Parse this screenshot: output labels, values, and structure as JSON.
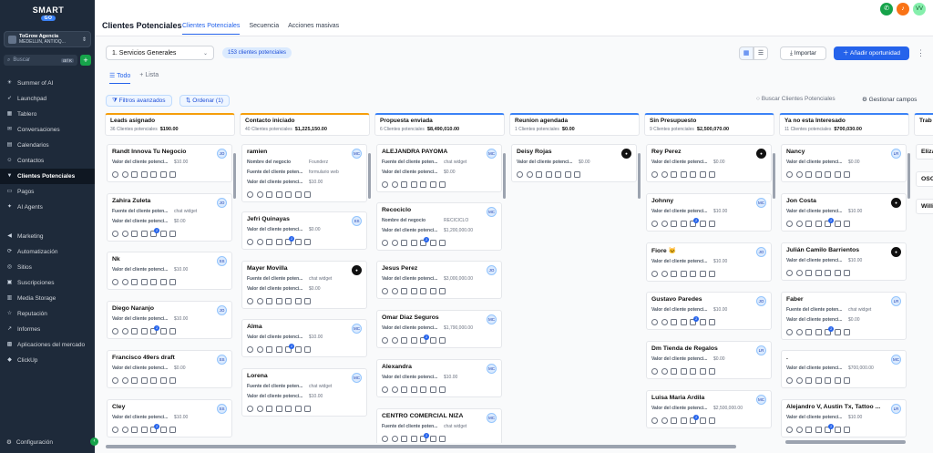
{
  "brand": {
    "name": "SMART",
    "sub": "GO"
  },
  "account": {
    "name": "ToGrow Agencia",
    "location": "MEDELLIN, ANTIOQ..."
  },
  "sidebar": {
    "search_placeholder": "Buscar",
    "shortcut": "ctrl K",
    "items": [
      {
        "label": "Summer of AI",
        "icon": "sun-icon"
      },
      {
        "label": "Launchpad",
        "icon": "rocket-icon"
      },
      {
        "label": "Tablero",
        "icon": "grid-icon"
      },
      {
        "label": "Conversaciones",
        "icon": "chat-icon"
      },
      {
        "label": "Calendarios",
        "icon": "calendar-icon"
      },
      {
        "label": "Contactos",
        "icon": "contacts-icon"
      },
      {
        "label": "Clientes Potenciales",
        "icon": "funnel-icon",
        "active": true
      },
      {
        "label": "Pagos",
        "icon": "card-icon"
      },
      {
        "label": "AI Agents",
        "icon": "sparkle-icon"
      },
      {
        "label": "Marketing",
        "icon": "megaphone-icon"
      },
      {
        "label": "Automatización",
        "icon": "automation-icon"
      },
      {
        "label": "Sitios",
        "icon": "globe-icon"
      },
      {
        "label": "Suscripciones",
        "icon": "subscription-icon"
      },
      {
        "label": "Media Storage",
        "icon": "storage-icon"
      },
      {
        "label": "Reputación",
        "icon": "star-icon"
      },
      {
        "label": "Informes",
        "icon": "chart-icon"
      },
      {
        "label": "Aplicaciones del mercado",
        "icon": "apps-icon"
      },
      {
        "label": "ClickUp",
        "icon": "clickup-icon"
      }
    ],
    "settings": "Configuración"
  },
  "header": {
    "title": "Clientes Potenciales",
    "tabs": [
      "Clientes Potenciales",
      "Secuencia",
      "Acciones masivas"
    ],
    "user_initials": "VV"
  },
  "toolbar": {
    "pipeline": "1. Servicios Generales",
    "count": "153 clientes potenciales",
    "import": "Importar",
    "add": "Añadir oportunidad",
    "view_tabs": [
      "Todo",
      "Lista"
    ],
    "filters": "Filtros avanzados",
    "sort": "Ordenar (1)",
    "search_placeholder": "Buscar Clientes Potenciales",
    "manage": "Gestionar campos"
  },
  "colors": {
    "accent": "#2563eb",
    "sidebar": "#1e2a3a"
  },
  "columns": [
    {
      "name": "Leads asignado",
      "count": "36 Clientes potenciales",
      "value": "$190.00",
      "color": "#f59e0b",
      "cards": [
        {
          "name": "Randt Innova Tu Negocio",
          "av": "JO",
          "fields": [
            [
              "Valor del cliente potenci...",
              "$10.00"
            ]
          ]
        },
        {
          "name": "Zahira Zuleta",
          "av": "JO",
          "fields": [
            [
              "Fuente del cliente poten...",
              "chat widget"
            ],
            [
              "Valor del cliente potenci...",
              "$0.00"
            ]
          ]
        },
        {
          "name": "Nk",
          "av": "SS",
          "fields": [
            [
              "Valor del cliente potenci...",
              "$10.00"
            ]
          ]
        },
        {
          "name": "Diego Naranjo",
          "av": "JO",
          "fields": [
            [
              "Valor del cliente potenci...",
              "$10.00"
            ]
          ]
        },
        {
          "name": "Francisco 49ers draft",
          "av": "SS",
          "fields": [
            [
              "Valor del cliente potenci...",
              "$0.00"
            ]
          ]
        },
        {
          "name": "Cley",
          "av": "SS",
          "fields": [
            [
              "Valor del cliente potenci...",
              "$10.00"
            ]
          ]
        }
      ]
    },
    {
      "name": "Contacto iniciado",
      "count": "40 Clientes potenciales",
      "value": "$1,225,150.00",
      "color": "#f59e0b",
      "cards": [
        {
          "name": "ramien",
          "av": "MC",
          "fields": [
            [
              "Nombre del negocio",
              "Founderz"
            ],
            [
              "Fuente del cliente poten...",
              "formulario web"
            ],
            [
              "Valor del cliente potenci...",
              "$10.00"
            ]
          ]
        },
        {
          "name": "Jefri Quinayas",
          "av": "SS",
          "fields": [
            [
              "Valor del cliente potenci...",
              "$0.00"
            ]
          ]
        },
        {
          "name": "Mayer Movilla",
          "av": "",
          "dark": true,
          "fields": [
            [
              "Fuente del cliente poten...",
              "chat widget"
            ],
            [
              "Valor del cliente potenci...",
              "$0.00"
            ]
          ]
        },
        {
          "name": "Alma",
          "av": "MC",
          "fields": [
            [
              "Valor del cliente potenci...",
              "$10.00"
            ]
          ]
        },
        {
          "name": "Lorena",
          "av": "MC",
          "fields": [
            [
              "Fuente del cliente poten...",
              "chat widget"
            ],
            [
              "Valor del cliente potenci...",
              "$10.00"
            ]
          ]
        }
      ]
    },
    {
      "name": "Propuesta enviada",
      "count": "6 Clientes potenciales",
      "value": "$8,490,010.00",
      "color": "#3b82f6",
      "cards": [
        {
          "name": "ALEJANDRA PAYOMA",
          "av": "MC",
          "fields": [
            [
              "Fuente del cliente poten...",
              "chat widget"
            ],
            [
              "Valor del cliente potenci...",
              "$0.00"
            ]
          ]
        },
        {
          "name": "Recociclo",
          "av": "MC",
          "fields": [
            [
              "Nombre del negocio",
              "RECICICLO"
            ],
            [
              "Valor del cliente potenci...",
              "$1,200,000.00"
            ]
          ]
        },
        {
          "name": "Jesus Perez",
          "av": "JO",
          "fields": [
            [
              "Valor del cliente potenci...",
              "$3,000,000.00"
            ]
          ]
        },
        {
          "name": "Omar Diaz Seguros",
          "av": "MC",
          "fields": [
            [
              "Valor del cliente potenci...",
              "$1,790,000.00"
            ]
          ]
        },
        {
          "name": "Alexandra",
          "av": "MC",
          "fields": [
            [
              "Valor del cliente potenci...",
              "$10.00"
            ]
          ]
        },
        {
          "name": "CENTRO COMERCIAL NIZA",
          "av": "MC",
          "fields": [
            [
              "Fuente del cliente poten...",
              "chat widget"
            ]
          ]
        }
      ]
    },
    {
      "name": "Reunion agendada",
      "count": "1 Clientes potenciales",
      "value": "$0.00",
      "color": "#3b82f6",
      "cards": [
        {
          "name": "Deisy Rojas",
          "av": "",
          "dark": true,
          "fields": [
            [
              "Valor del cliente potenci...",
              "$0.00"
            ]
          ]
        }
      ]
    },
    {
      "name": "Sin Presupuesto",
      "count": "9 Clientes potenciales",
      "value": "$2,500,070.00",
      "color": "#3b82f6",
      "cards": [
        {
          "name": "Rey Perez",
          "av": "",
          "dark": true,
          "fields": [
            [
              "Valor del cliente potenci...",
              "$0.00"
            ]
          ]
        },
        {
          "name": "Johnny",
          "av": "MC",
          "fields": [
            [
              "Valor del cliente potenci...",
              "$10.00"
            ]
          ]
        },
        {
          "name": "Fiore 🐱",
          "av": "JO",
          "fields": [
            [
              "Valor del cliente potenci...",
              "$10.00"
            ]
          ]
        },
        {
          "name": "Gustavo Paredes",
          "av": "JO",
          "fields": [
            [
              "Valor del cliente potenci...",
              "$10.00"
            ]
          ]
        },
        {
          "name": "Dm Tienda de Regalos",
          "av": "LR",
          "fields": [
            [
              "Valor del cliente potenci...",
              "$0.00"
            ]
          ]
        },
        {
          "name": "Luisa Maria Ardila",
          "av": "MC",
          "fields": [
            [
              "Valor del cliente potenci...",
              "$2,500,000.00"
            ]
          ]
        }
      ]
    },
    {
      "name": "Ya no esta Interesado",
      "count": "11 Clientes potenciales",
      "value": "$700,030.00",
      "color": "#3b82f6",
      "cards": [
        {
          "name": "Nancy",
          "av": "LR",
          "fields": [
            [
              "Valor del cliente potenci...",
              "$0.00"
            ]
          ]
        },
        {
          "name": "Jon Costa",
          "av": "",
          "dark": true,
          "fields": [
            [
              "Valor del cliente potenci...",
              "$10.00"
            ]
          ]
        },
        {
          "name": "Julián Camilo Barrientos",
          "av": "",
          "dark": true,
          "fields": [
            [
              "Valor del cliente potenci...",
              "$10.00"
            ]
          ]
        },
        {
          "name": "Faber",
          "av": "LR",
          "fields": [
            [
              "Fuente del cliente poten...",
              "chat widget"
            ],
            [
              "Valor del cliente potenci...",
              "$0.00"
            ]
          ]
        },
        {
          "name": ".",
          "av": "MC",
          "fields": [
            [
              "Valor del cliente potenci...",
              "$700,000.00"
            ]
          ]
        },
        {
          "name": "Alejandro V, Austin Tx, Tattoo ...",
          "av": "LR",
          "fields": [
            [
              "Valor del cliente potenci...",
              "$10.00"
            ]
          ]
        }
      ]
    },
    {
      "name": "Trab",
      "count": "",
      "value": "",
      "color": "#3b82f6",
      "cards": [
        {
          "name": "Eliza",
          "av": "",
          "fields": []
        },
        {
          "name": "OSO",
          "av": "",
          "fields": []
        },
        {
          "name": "Willi",
          "av": "",
          "fields": []
        }
      ]
    }
  ]
}
